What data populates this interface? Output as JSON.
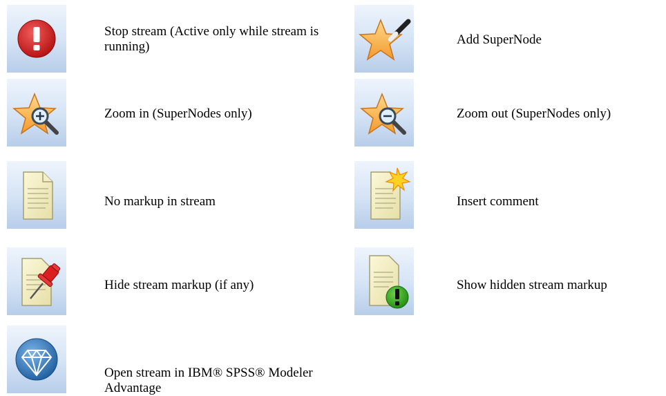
{
  "rows": [
    {
      "left": {
        "icon": "stop-icon",
        "label": "Stop stream (Active only while stream is running)"
      },
      "right": {
        "icon": "add-supernode-icon",
        "label": "Add SuperNode"
      }
    },
    {
      "left": {
        "icon": "zoom-in-icon",
        "label": "Zoom in (SuperNodes only)"
      },
      "right": {
        "icon": "zoom-out-icon",
        "label": "Zoom out (SuperNodes only)"
      }
    },
    {
      "left": {
        "icon": "document-icon",
        "label": "No markup in stream"
      },
      "right": {
        "icon": "insert-comment-icon",
        "label": "Insert comment"
      }
    },
    {
      "left": {
        "icon": "hide-markup-icon",
        "label": "Hide stream markup (if any)"
      },
      "right": {
        "icon": "show-markup-icon",
        "label": "Show hidden stream markup"
      }
    },
    {
      "left": {
        "icon": "modeler-advantage-icon",
        "label": "Open stream in IBM® SPSS® Modeler Advantage"
      }
    }
  ]
}
